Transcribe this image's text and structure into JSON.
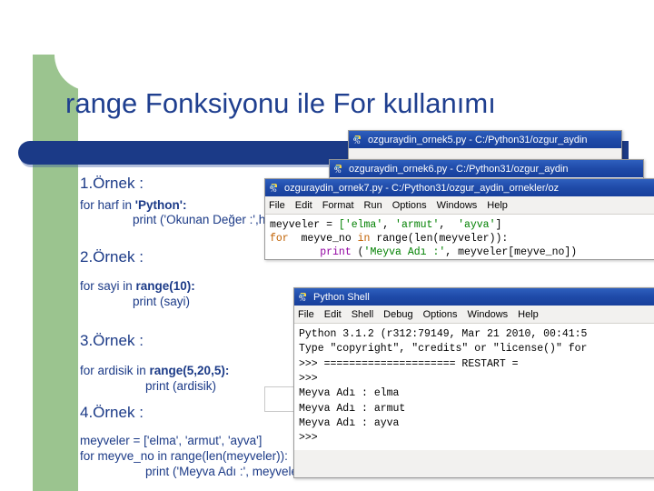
{
  "slide": {
    "title": "range Fonksiyonu ile For kullanımı",
    "examples": [
      {
        "heading": "1.Örnek :",
        "lines": [
          "for harf in 'Python':",
          "print ('Okunan Değer :',harf)"
        ]
      },
      {
        "heading": "2.Örnek :",
        "lines": [
          "for sayi in range(10):",
          "print (sayi)"
        ]
      },
      {
        "heading": "3.Örnek :",
        "lines": [
          "for ardisik in range(5,20,5):",
          "print (ardisik)"
        ]
      },
      {
        "heading": "4.Örnek :",
        "lines": [
          "meyveler = ['elma', 'armut', 'ayva']",
          "for meyve_no in range(len(meyveler)):",
          "print ('Meyva Adı :', meyveler[meyve_no])"
        ]
      }
    ]
  },
  "windows": {
    "win5": {
      "icon": "python-idle-icon",
      "title": "ozguraydin_ornek5.py - C:/Python31/ozgur_aydin"
    },
    "win6": {
      "icon": "python-idle-icon",
      "title": "ozguraydin_ornek6.py - C:/Python31/ozgur_aydin"
    },
    "win7": {
      "icon": "python-idle-icon",
      "title": "ozguraydin_ornek7.py - C:/Python31/ozgur_aydin_ornekler/oz",
      "menu": [
        "File",
        "Edit",
        "Format",
        "Run",
        "Options",
        "Windows",
        "Help"
      ],
      "code_lines": [
        "meyveler = ['elma', 'armut',  'ayva']",
        "for  meyve_no in range(len(meyveler)):",
        "        print ('Meyva Adı :', meyveler[meyve_no])"
      ]
    },
    "shell": {
      "icon": "python-idle-icon",
      "title": "Python Shell",
      "menu": [
        "File",
        "Edit",
        "Shell",
        "Debug",
        "Options",
        "Windows",
        "Help"
      ],
      "lines": [
        "Python 3.1.2 (r312:79149, Mar 21 2010, 00:41:5",
        "Type \"copyright\", \"credits\" or \"license()\" for",
        ">>> ===================== RESTART =",
        ">>>",
        "Meyva Adı : elma",
        "Meyva Adı : armut",
        "Meyva Adı : ayva",
        ">>>"
      ]
    }
  },
  "colors": {
    "title_blue": "#1f3f8f",
    "bar_blue": "#1b3a87",
    "band_green": "#9bc48f",
    "window_title_blue": "#1f4aa8",
    "keyword_purple": "#9000a0",
    "keyword_orange": "#c06000",
    "string_green": "#008000"
  }
}
